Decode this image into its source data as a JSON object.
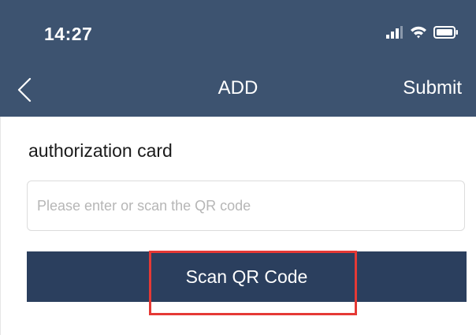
{
  "status_bar": {
    "time": "14:27",
    "icons": [
      "signal-icon",
      "wifi-icon",
      "battery-icon"
    ]
  },
  "nav": {
    "back_icon": "chevron-left-icon",
    "title": "ADD",
    "submit_label": "Submit"
  },
  "form": {
    "field_label": "authorization card",
    "input_placeholder": "Please enter or scan the QR code",
    "input_value": "",
    "scan_button_label": "Scan QR Code"
  },
  "colors": {
    "header_bg": "#3d5370",
    "button_bg": "#2b3f5e",
    "highlight": "#e53935"
  }
}
